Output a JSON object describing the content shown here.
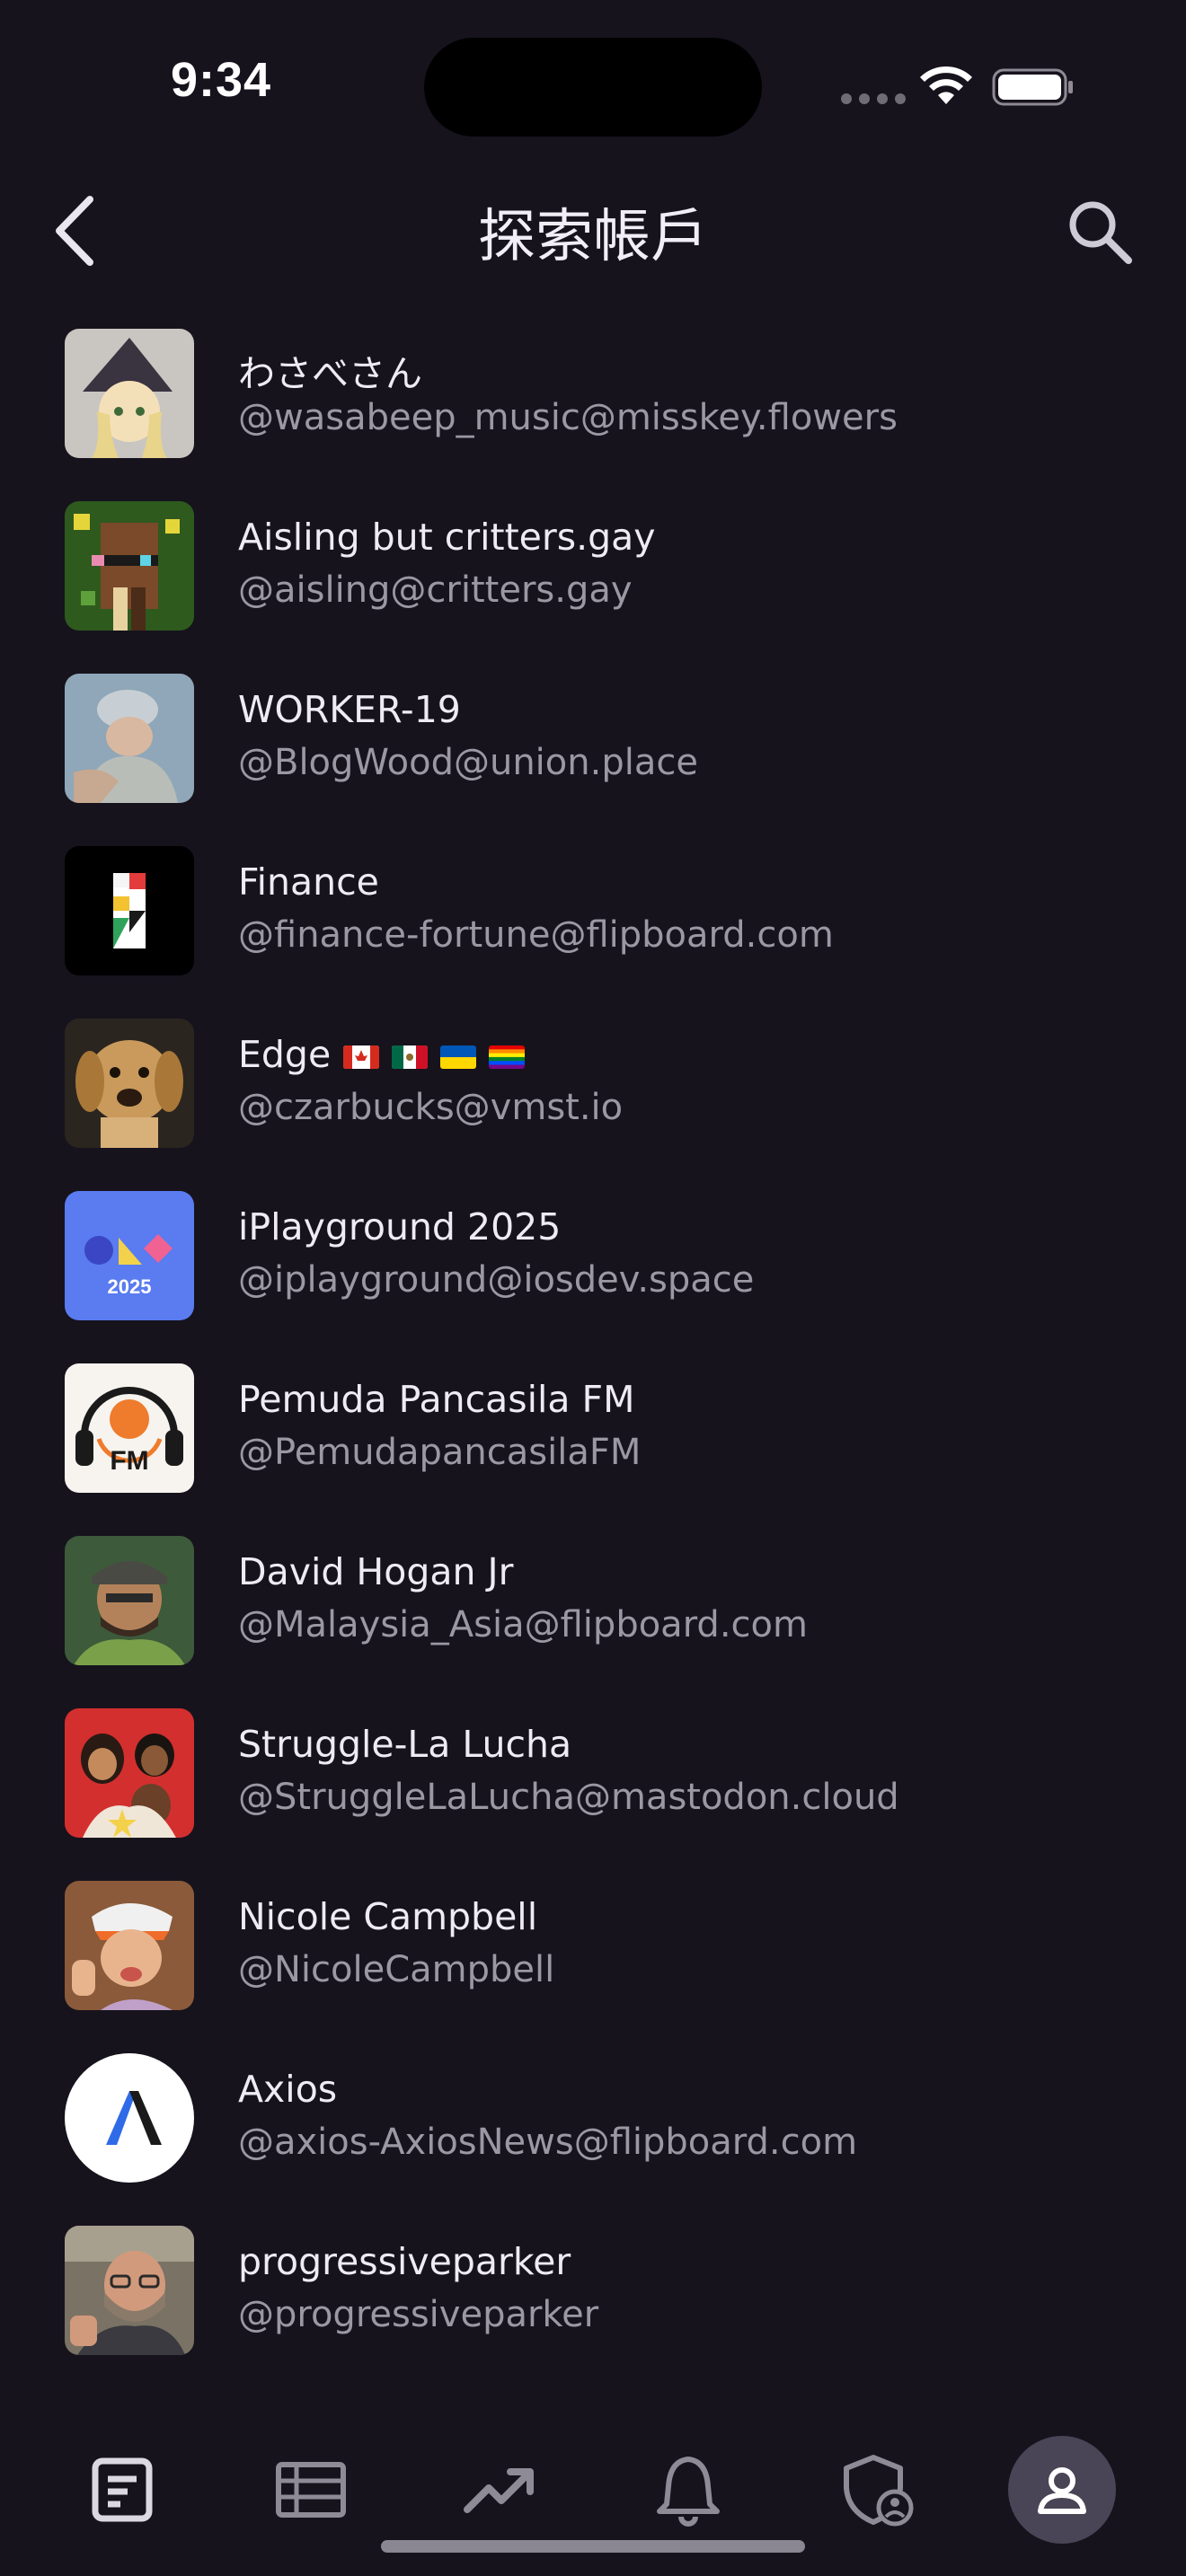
{
  "status_bar": {
    "time": "9:34"
  },
  "header": {
    "title": "探索帳戶"
  },
  "accounts": [
    {
      "name": "わさべさん",
      "handle": "@wasabeep_music@misskey.flowers"
    },
    {
      "name": "Aisling but critters.gay",
      "handle": "@aisling@critters.gay"
    },
    {
      "name": "WORKER-19",
      "handle": "@BlogWood@union.place"
    },
    {
      "name": "Finance",
      "handle": "@finance-fortune@flipboard.com"
    },
    {
      "name": "Edge",
      "handle": "@czarbucks@vmst.io",
      "flags": [
        "canada-flag",
        "mexico-flag",
        "ukraine-flag",
        "rainbow-flag"
      ]
    },
    {
      "name": "iPlayground 2025",
      "handle": "@iplayground@iosdev.space",
      "avatar_text": "2025"
    },
    {
      "name": "Pemuda Pancasila FM",
      "handle": "@PemudapancasilaFM",
      "avatar_text": "FM"
    },
    {
      "name": "David Hogan Jr",
      "handle": "@Malaysia_Asia@flipboard.com"
    },
    {
      "name": "Struggle-La Lucha",
      "handle": "@StruggleLaLucha@mastodon.cloud"
    },
    {
      "name": "Nicole Campbell",
      "handle": "@NicoleCampbell"
    },
    {
      "name": "Axios",
      "handle": "@axios-AxiosNews@flipboard.com"
    },
    {
      "name": "progressiveparker",
      "handle": "@progressiveparker"
    }
  ],
  "tab_bar": {
    "tabs": [
      "timeline-icon",
      "list-icon",
      "trending-icon",
      "bell-icon",
      "shield-person-icon",
      "person-icon"
    ],
    "active": "person-icon"
  },
  "colors": {
    "background": "#16131d",
    "active_tab": "#4a4556",
    "secondary_text": "#9b98a3"
  }
}
